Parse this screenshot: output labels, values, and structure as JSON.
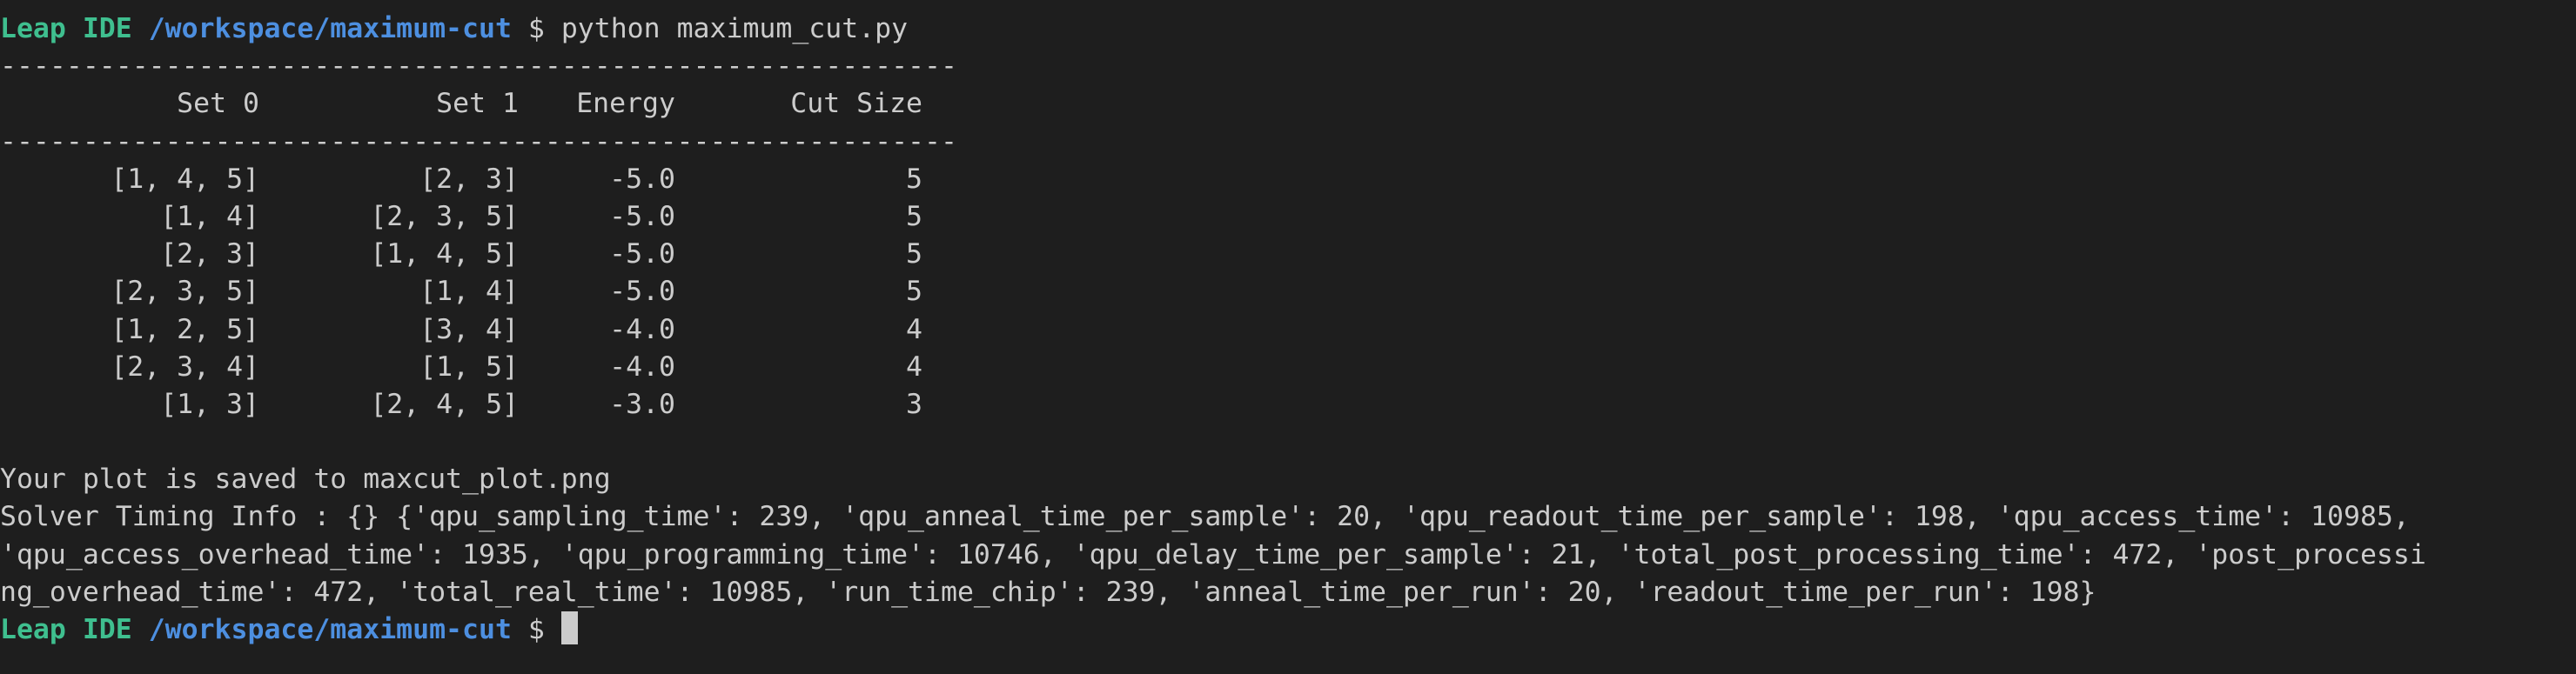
{
  "prompt": {
    "host": "Leap IDE",
    "path": "/workspace/maximum-cut",
    "symbol": "$",
    "command": "python maximum_cut.py"
  },
  "separator": "----------------------------------------------------------",
  "table": {
    "headers": [
      "Set 0",
      "Set 1",
      "Energy",
      "Cut Size"
    ],
    "rows": [
      [
        "[1, 4, 5]",
        "[2, 3]",
        "-5.0",
        "5"
      ],
      [
        "[1, 4]",
        "[2, 3, 5]",
        "-5.0",
        "5"
      ],
      [
        "[2, 3]",
        "[1, 4, 5]",
        "-5.0",
        "5"
      ],
      [
        "[2, 3, 5]",
        "[1, 4]",
        "-5.0",
        "5"
      ],
      [
        "[1, 2, 5]",
        "[3, 4]",
        "-4.0",
        "4"
      ],
      [
        "[2, 3, 4]",
        "[1, 5]",
        "-4.0",
        "4"
      ],
      [
        "[1, 3]",
        "[2, 4, 5]",
        "-3.0",
        "3"
      ]
    ]
  },
  "output": {
    "plot_saved": "Your plot is saved to maxcut_plot.png",
    "timing_line_1": "Solver Timing Info : {} {'qpu_sampling_time': 239, 'qpu_anneal_time_per_sample': 20, 'qpu_readout_time_per_sample': 198, 'qpu_access_time': 10985,",
    "timing_line_2": "'qpu_access_overhead_time': 1935, 'qpu_programming_time': 10746, 'qpu_delay_time_per_sample': 21, 'total_post_processing_time': 472, 'post_processi",
    "timing_line_3": "ng_overhead_time': 472, 'total_real_time': 10985, 'run_time_chip': 239, 'anneal_time_per_run': 20, 'readout_time_per_run': 198}"
  },
  "colors": {
    "background": "#1e1e1e",
    "text": "#cccccc",
    "host": "#3fbf8f",
    "path": "#4d8fe0"
  }
}
